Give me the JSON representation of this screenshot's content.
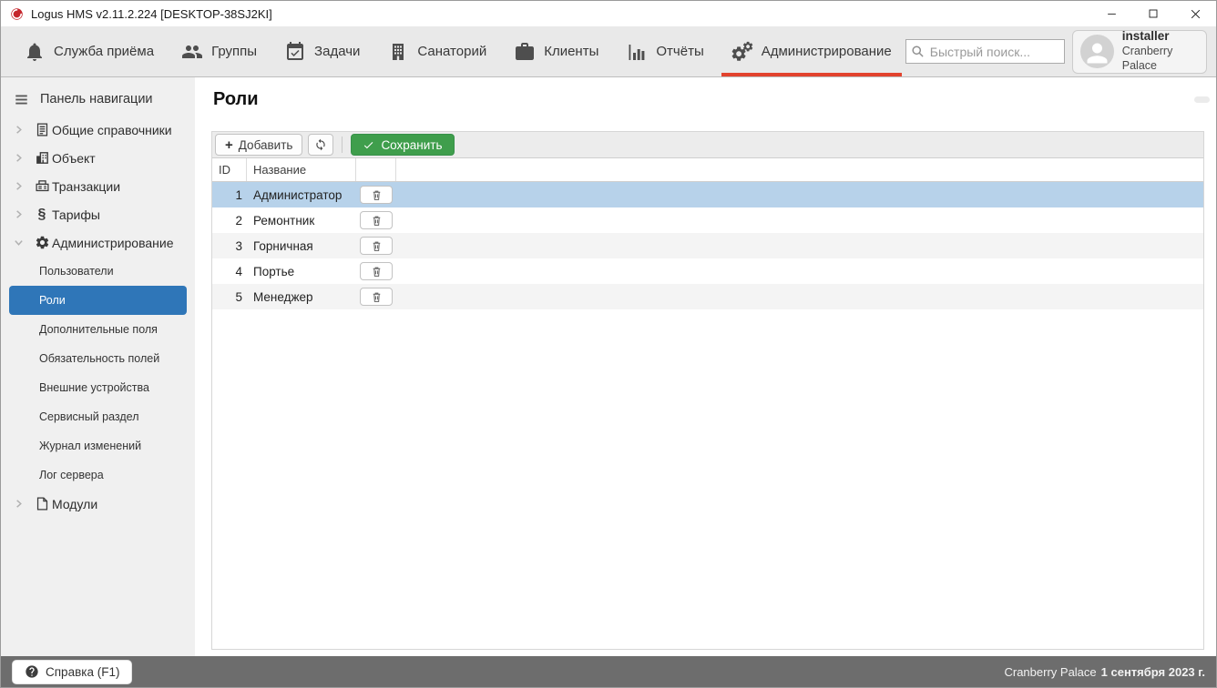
{
  "window": {
    "title": "Logus HMS v2.11.2.224 [DESKTOP-38SJ2KI]"
  },
  "toolbar": {
    "tabs": [
      {
        "label": "Служба приёма",
        "icon": "bell-icon",
        "active": false
      },
      {
        "label": "Группы",
        "icon": "users-icon",
        "active": false
      },
      {
        "label": "Задачи",
        "icon": "calendar-check-icon",
        "active": false
      },
      {
        "label": "Санаторий",
        "icon": "building-icon",
        "active": false
      },
      {
        "label": "Клиенты",
        "icon": "briefcase-icon",
        "active": false
      },
      {
        "label": "Отчёты",
        "icon": "bar-chart-icon",
        "active": false
      },
      {
        "label": "Администрирование",
        "icon": "gears-icon",
        "active": true
      }
    ],
    "search": {
      "placeholder": "Быстрый поиск...",
      "value": ""
    },
    "user": {
      "name": "installer",
      "property": "Cranberry Palace"
    }
  },
  "sidebar": {
    "header": "Панель навигации",
    "sections": [
      {
        "label": "Общие справочники",
        "icon": "document-icon",
        "state": "collapsed"
      },
      {
        "label": "Объект",
        "icon": "building-icon",
        "state": "collapsed"
      },
      {
        "label": "Транзакции",
        "icon": "register-icon",
        "state": "collapsed"
      },
      {
        "label": "Тарифы",
        "icon": "paragraph-icon",
        "state": "collapsed"
      },
      {
        "label": "Администрирование",
        "icon": "gear-icon",
        "state": "expanded"
      },
      {
        "label": "Модули",
        "icon": "module-icon",
        "state": "collapsed"
      }
    ],
    "admin_items": [
      {
        "label": "Пользователи",
        "selected": false
      },
      {
        "label": "Роли",
        "selected": true
      },
      {
        "label": "Дополнительные поля",
        "selected": false
      },
      {
        "label": "Обязательность полей",
        "selected": false
      },
      {
        "label": "Внешние устройства",
        "selected": false
      },
      {
        "label": "Сервисный раздел",
        "selected": false
      },
      {
        "label": "Журнал изменений",
        "selected": false
      },
      {
        "label": "Лог сервера",
        "selected": false
      }
    ]
  },
  "main": {
    "title": "Роли",
    "actions": {
      "add": "Добавить",
      "save": "Сохранить"
    },
    "table": {
      "columns": [
        "ID",
        "Название",
        ""
      ],
      "rows": [
        {
          "id": "1",
          "name": "Администратор",
          "selected": true
        },
        {
          "id": "2",
          "name": "Ремонтник",
          "selected": false
        },
        {
          "id": "3",
          "name": "Горничная",
          "selected": false
        },
        {
          "id": "4",
          "name": "Портье",
          "selected": false
        },
        {
          "id": "5",
          "name": "Менеджер",
          "selected": false
        }
      ]
    }
  },
  "footer": {
    "help": "Справка (F1)",
    "property": "Cranberry Palace",
    "date": "1 сентября 2023 г."
  },
  "icons": {
    "paragraph_glyph": "§",
    "plus_glyph": "+"
  },
  "colors": {
    "accent_red": "#e2432e",
    "selected_blue": "#2f76b8",
    "row_selected": "#b7d2ea",
    "save_green": "#3f9e4c",
    "footer_gray": "#6d6d6d"
  }
}
